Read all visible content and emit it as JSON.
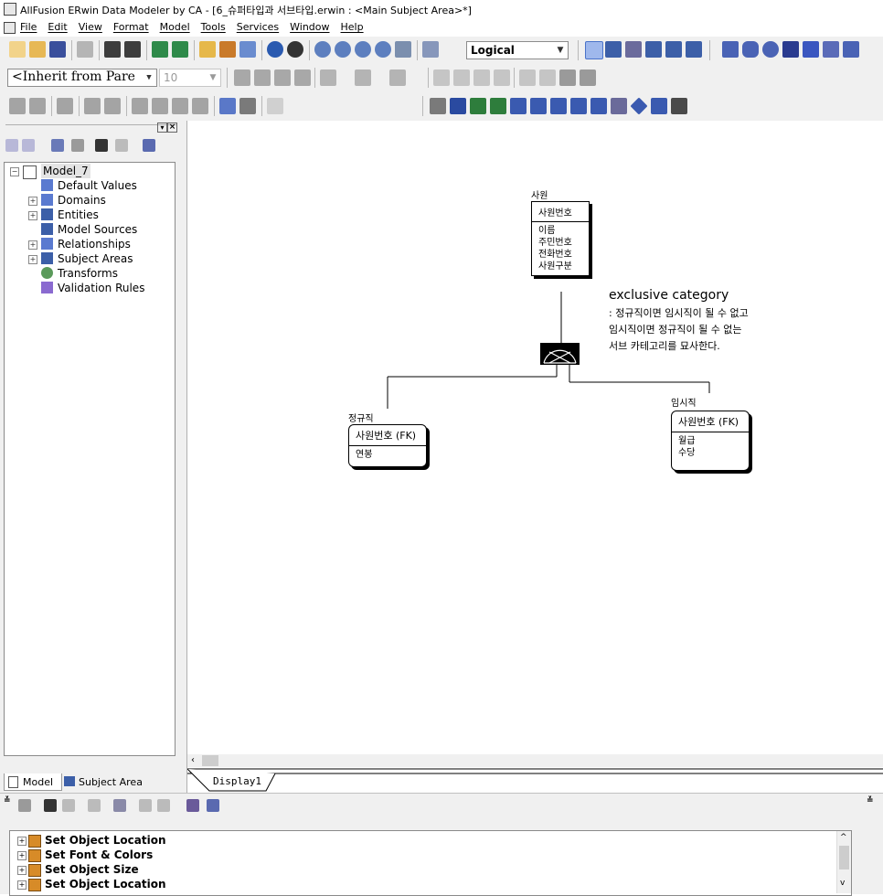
{
  "window": {
    "title": "AllFusion ERwin Data Modeler by CA - [6_슈퍼타입과 서브타입.erwin : <Main Subject Area>*]"
  },
  "menu": [
    "File",
    "Edit",
    "View",
    "Format",
    "Model",
    "Tools",
    "Services",
    "Window",
    "Help"
  ],
  "toolbar": {
    "view_mode": "Logical",
    "font_name": "<Inherit from Pare",
    "font_size": "10"
  },
  "explorer": {
    "root": "Model_7",
    "items": [
      "Default Values",
      "Domains",
      "Entities",
      "Model Sources",
      "Relationships",
      "Subject Areas",
      "Transforms",
      "Validation Rules"
    ],
    "tabs": [
      "Model",
      "Subject Area"
    ]
  },
  "diagram": {
    "supertype": {
      "name": "사원",
      "key": "사원번호",
      "attributes": [
        "이름",
        "주민번호",
        "전화번호",
        "사원구분"
      ]
    },
    "subtype_left": {
      "name": "정규직",
      "key": "사원번호 (FK)",
      "attributes": [
        "연봉"
      ]
    },
    "subtype_right": {
      "name": "임시직",
      "key": "사원번호 (FK)",
      "attributes": [
        "월급",
        "수당"
      ]
    },
    "note": {
      "heading": "exclusive category",
      "lines": [
        ": 정규직이면 임시직이 될 수 없고",
        "임시직이면 정규직이 될 수 없는",
        "서브 카테고리를 묘사한다."
      ]
    }
  },
  "tabs": {
    "display": "Display1"
  },
  "actions": [
    "Set Object Location",
    "Set Font & Colors",
    "Set Object Size",
    "Set Object Location"
  ],
  "icons": [
    "app-icon",
    "new-icon",
    "open-icon",
    "save-icon",
    "print-icon",
    "find-icon",
    "zoom-in-icon",
    "zoom-out-icon",
    "pointer-icon",
    "entity-icon",
    "relationship-icon",
    "expand-icon",
    "scroll-left-icon"
  ]
}
